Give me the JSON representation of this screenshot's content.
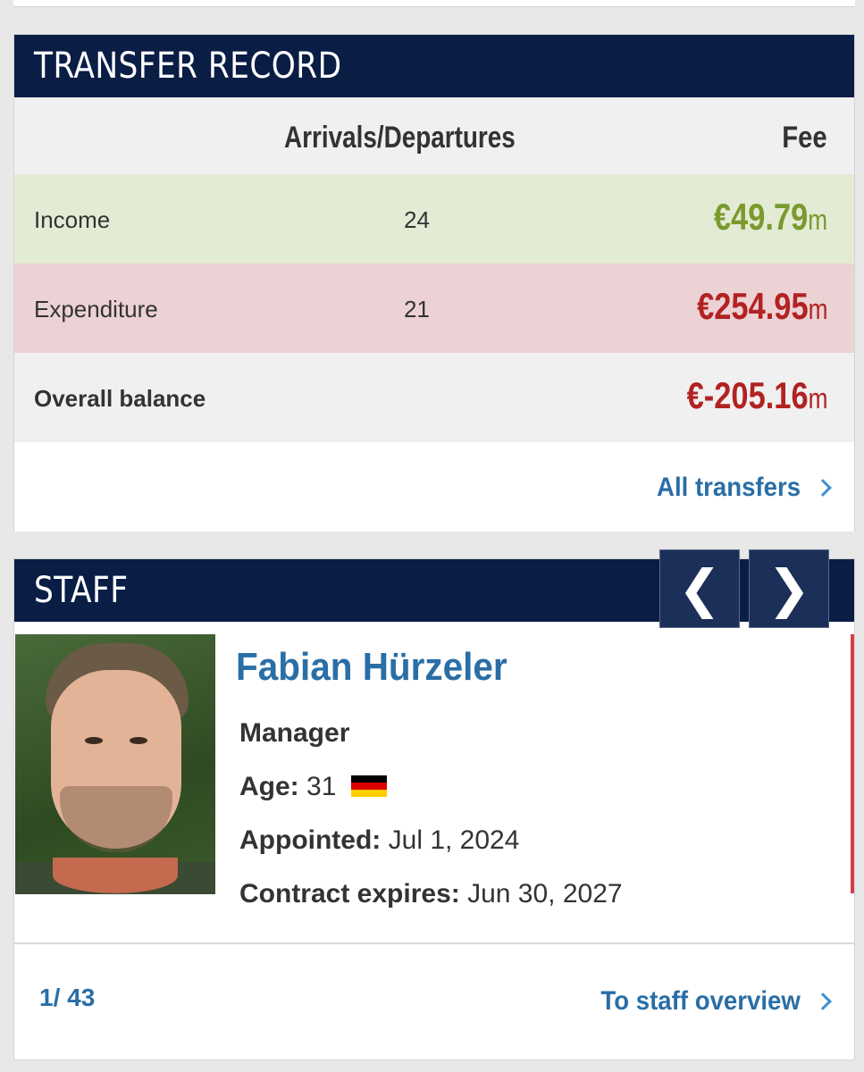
{
  "transfer_record": {
    "title": "TRANSFER RECORD",
    "columns": {
      "arrivals_departures": "Arrivals/Departures",
      "fee": "Fee"
    },
    "income": {
      "label": "Income",
      "count": "24",
      "value": "€49.79",
      "unit": "m"
    },
    "expenditure": {
      "label": "Expenditure",
      "count": "21",
      "value": "€254.95",
      "unit": "m"
    },
    "balance": {
      "label": "Overall balance",
      "value": "€-205.16",
      "unit": "m"
    },
    "all_transfers_link": "All transfers"
  },
  "staff": {
    "title": "STAFF",
    "prev_arrow": "❮",
    "next_arrow": "❯",
    "name": "Fabian Hürzeler",
    "role": "Manager",
    "age_label": "Age:",
    "age": "31",
    "nationality_flag": "germany-flag",
    "appointed_label": "Appointed:",
    "appointed": "Jul 1, 2024",
    "contract_label": "Contract expires:",
    "contract": "Jun 30, 2027",
    "pager": "1/ 43",
    "overview_link": "To staff overview"
  },
  "colors": {
    "header_bg": "#0a1d45",
    "income_bg": "#e4ebd4",
    "expenditure_bg": "#ecd2d4",
    "positive": "#7a9a2e",
    "negative": "#b22222",
    "link": "#2a6ea6"
  }
}
